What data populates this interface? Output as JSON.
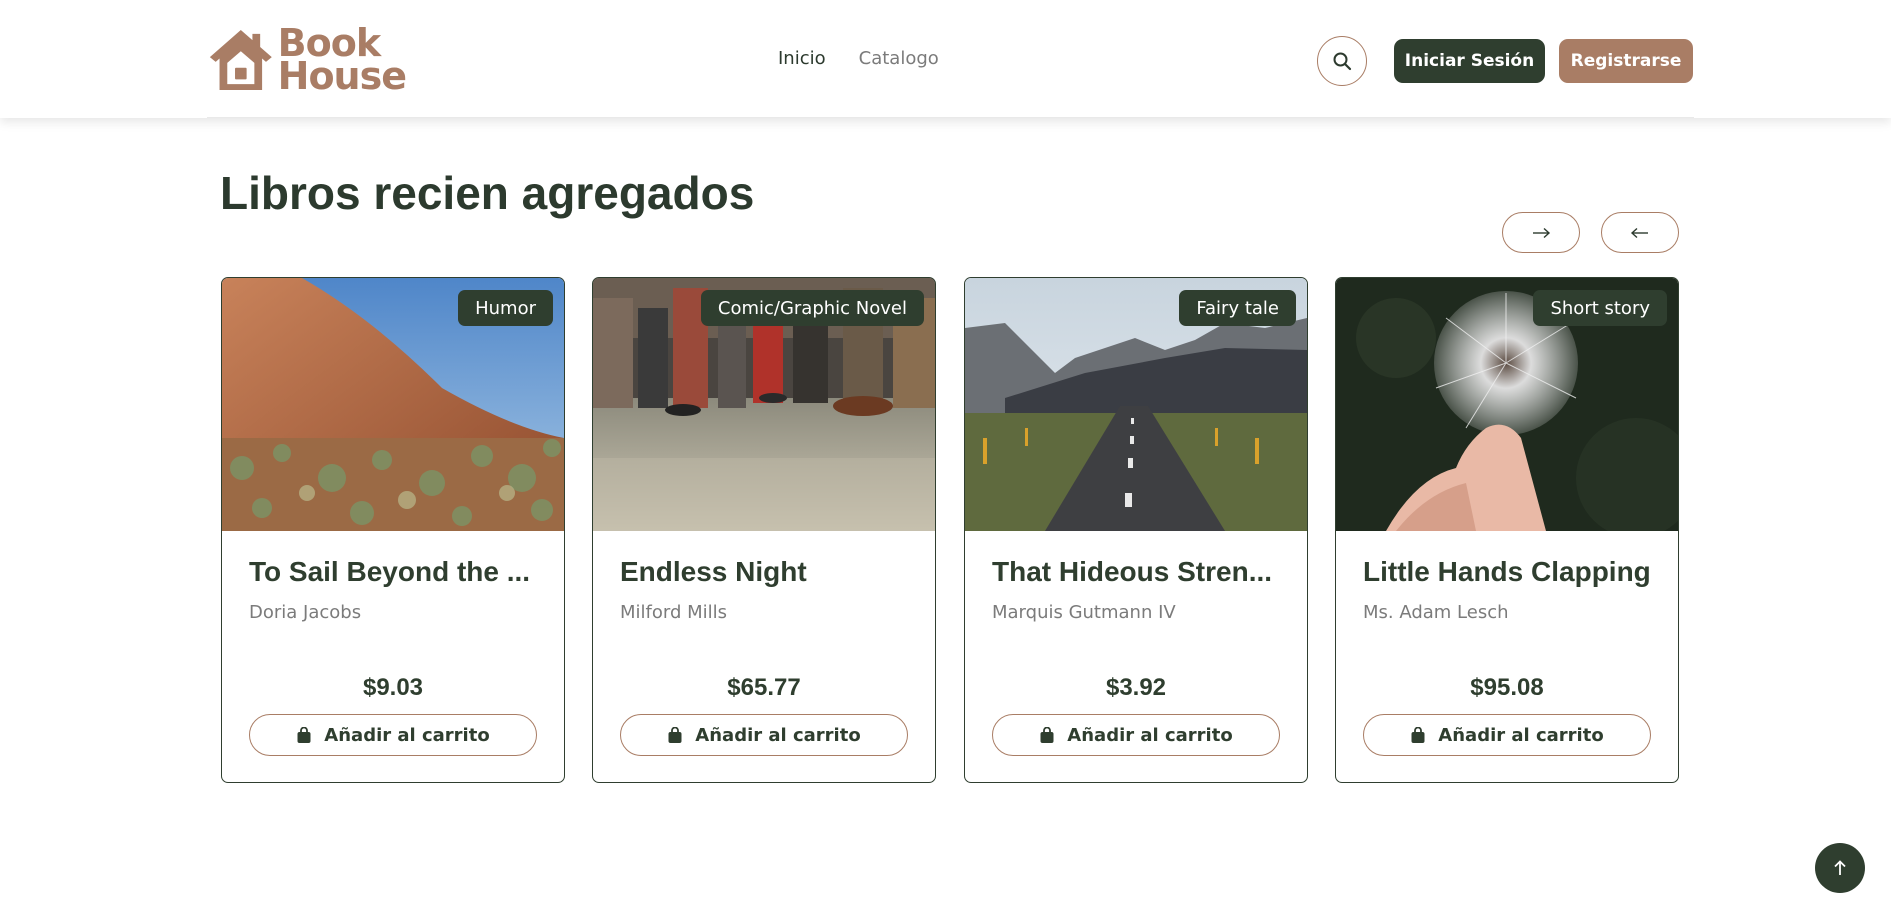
{
  "brand": {
    "line1": "Book",
    "line2": "House",
    "color": "#a97d65"
  },
  "nav": {
    "items": [
      {
        "label": "Inicio"
      },
      {
        "label": "Catalogo"
      }
    ]
  },
  "header": {
    "login_label": "Iniciar Sesión",
    "register_label": "Registrarse"
  },
  "section": {
    "title": "Libros recien agregados"
  },
  "books": [
    {
      "genre": "Humor",
      "title": "To Sail Beyond the ...",
      "author": "Doria Jacobs",
      "price": "$9.03",
      "cart_label": "Añadir al carrito"
    },
    {
      "genre": "Comic/Graphic Novel",
      "title": "Endless Night",
      "author": "Milford Mills",
      "price": "$65.77",
      "cart_label": "Añadir al carrito"
    },
    {
      "genre": "Fairy tale",
      "title": "That Hideous Stren...",
      "author": "Marquis Gutmann IV",
      "price": "$3.92",
      "cart_label": "Añadir al carrito"
    },
    {
      "genre": "Short story",
      "title": "Little Hands Clapping",
      "author": "Ms. Adam Lesch",
      "price": "$95.08",
      "cart_label": "Añadir al carrito"
    }
  ],
  "colors": {
    "dark_green": "#2f3e2f",
    "accent_brown": "#a97d65",
    "muted_text": "#7b7b7b"
  },
  "icons": {
    "search": "search-icon",
    "next": "arrow-right-icon",
    "prev": "arrow-left-icon",
    "cart": "shopping-bag-icon",
    "to_top": "arrow-up-icon",
    "logo": "house-icon"
  }
}
